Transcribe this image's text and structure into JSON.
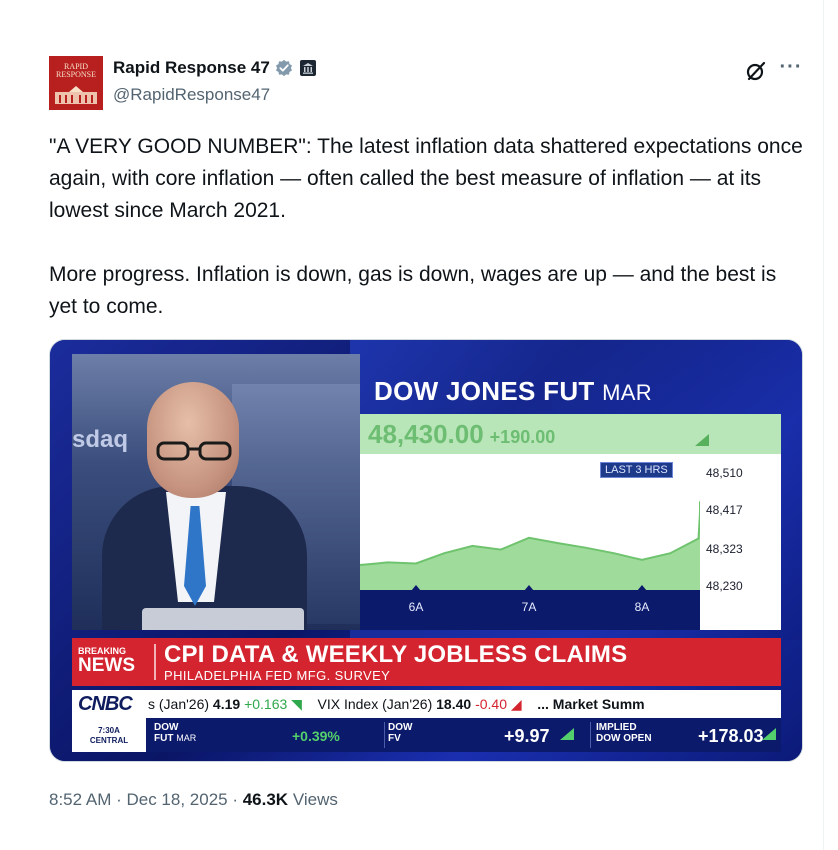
{
  "author": {
    "display_name": "Rapid Response 47",
    "handle": "@RapidResponse47",
    "avatar_text": "RAPID RESPONSE"
  },
  "tweet": {
    "paragraph1": "\"A VERY GOOD NUMBER\": The latest inflation data shattered expectations once again, with core inflation — often called the best measure of inflation — at its lowest since March 2021.",
    "paragraph2": "More progress. Inflation is down, gas is down, wages are up — and the best is yet to come."
  },
  "media": {
    "background_text": "sdaq",
    "chart_title": "DOW JONES FUT",
    "chart_month": "MAR",
    "price": "48,430.00",
    "price_change": "+190.00",
    "range_label": "LAST 3 HRS",
    "y_ticks": [
      "48,510",
      "48,417",
      "48,323",
      "48,230"
    ],
    "x_ticks": [
      "6A",
      "7A",
      "8A"
    ],
    "breaking_top": "BREAKING",
    "breaking_bottom": "NEWS",
    "headline": "CPI DATA & WEEKLY JOBLESS CLAIMS",
    "subheadline": "PHILADELPHIA FED MFG. SURVEY",
    "network": "CNBC",
    "ticker": {
      "item1_label": "s (Jan'26)",
      "item1_value": "4.19",
      "item1_change": "+0.163",
      "item2_label": "VIX Index (Jan'26)",
      "item2_value": "18.40",
      "item2_change": "-0.40",
      "item3_label": "... Market Summ"
    },
    "futures": {
      "time": "7:30A",
      "timezone": "CENTRAL",
      "dow_fut_label_top": "DOW",
      "dow_fut_label_bottom": "FUT",
      "dow_fut_month": "MAR",
      "dow_fut_change": "+0.39%",
      "dow_fv_label_top": "DOW",
      "dow_fv_label_bottom": "FV",
      "dow_fv_value": "+9.97",
      "implied_label_top": "IMPLIED",
      "implied_label_bottom": "DOW OPEN",
      "implied_value": "+178.03"
    }
  },
  "chart_data": {
    "type": "area",
    "title": "DOW JONES FUT MAR",
    "range": "LAST 3 HRS",
    "x": [
      "5:30A",
      "5:45A",
      "6:00A",
      "6:15A",
      "6:30A",
      "6:45A",
      "7:00A",
      "7:15A",
      "7:30A",
      "7:45A",
      "8:00A",
      "8:15A",
      "8:25A",
      "8:30A",
      "8:33A"
    ],
    "values": [
      48258,
      48265,
      48262,
      48290,
      48310,
      48300,
      48332,
      48318,
      48305,
      48290,
      48272,
      48290,
      48330,
      48400,
      48430
    ],
    "ylim": [
      48190,
      48560
    ],
    "y_ticks": [
      48510,
      48417,
      48323,
      48230
    ],
    "x_tick_labels": [
      "6A",
      "7A",
      "8A"
    ],
    "x_tick_positions": [
      2,
      6,
      10
    ],
    "colors": {
      "fill": "#9fdb9a",
      "line": "#6fc36f"
    }
  },
  "footer": {
    "timestamp": "8:52 AM · Dec 18, 2025 · ",
    "views_count": "46.3K",
    "views_label": " Views"
  },
  "colors": {
    "brand_red": "#d4242f",
    "cnbc_blue": "#0c1a6b",
    "positive_green": "#53d06b",
    "verified_gray": "#829aab"
  }
}
